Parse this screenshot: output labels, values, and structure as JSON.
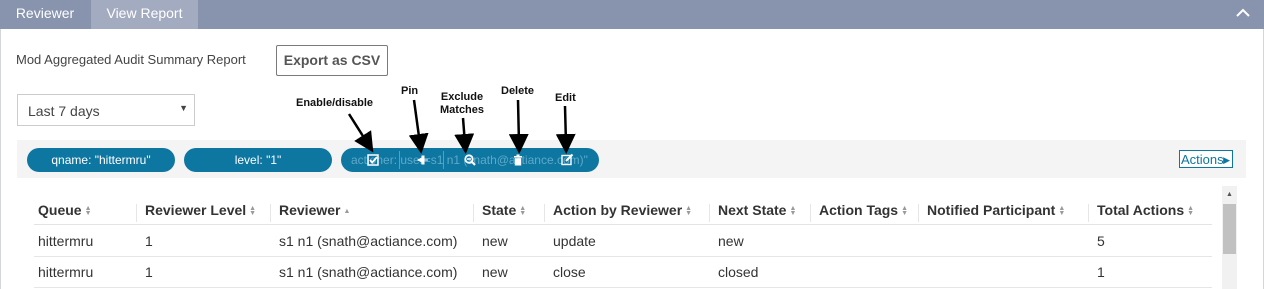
{
  "tabs": {
    "reviewer": "Reviewer",
    "view_report": "View Report"
  },
  "report": {
    "title": "Mod Aggregated Audit Summary Report",
    "export_label": "Export as CSV",
    "date_range": "Last 7 days"
  },
  "annotations": {
    "enable_disable": "Enable/disable",
    "pin": "Pin",
    "exclude_matches": "Exclude\nMatches",
    "delete": "Delete",
    "edit": "Edit"
  },
  "filters": {
    "qname": "qname: \"hittermru\"",
    "level": "level: \"1\"",
    "actioner_hidden": "actioner: user=s1 n1 (snath@actiance.com)\""
  },
  "actions_label": "Actions",
  "table": {
    "columns": [
      "Queue",
      "Reviewer Level",
      "Reviewer",
      "State",
      "Action by Reviewer",
      "Next State",
      "Action Tags",
      "Notified Participant",
      "Total Actions"
    ],
    "sorted_column": "Reviewer",
    "rows": [
      [
        "hittermru",
        "1",
        "s1 n1 (snath@actiance.com)",
        "new",
        "update",
        "new",
        "",
        "",
        "5"
      ],
      [
        "hittermru",
        "1",
        "s1 n1 (snath@actiance.com)",
        "new",
        "close",
        "closed",
        "",
        "",
        "1"
      ]
    ]
  },
  "colors": {
    "topbar": "#8893ae",
    "active_tab": "#a3abc1",
    "pill": "#0d76a1",
    "filterbar": "#f4f4f4"
  },
  "icons": [
    "chevron-up-icon",
    "checkbox-icon",
    "pin-icon",
    "search-minus-icon",
    "trash-icon",
    "edit-icon",
    "caret-right-icon",
    "caret-down-icon",
    "sort-icon",
    "sort-asc-icon"
  ]
}
